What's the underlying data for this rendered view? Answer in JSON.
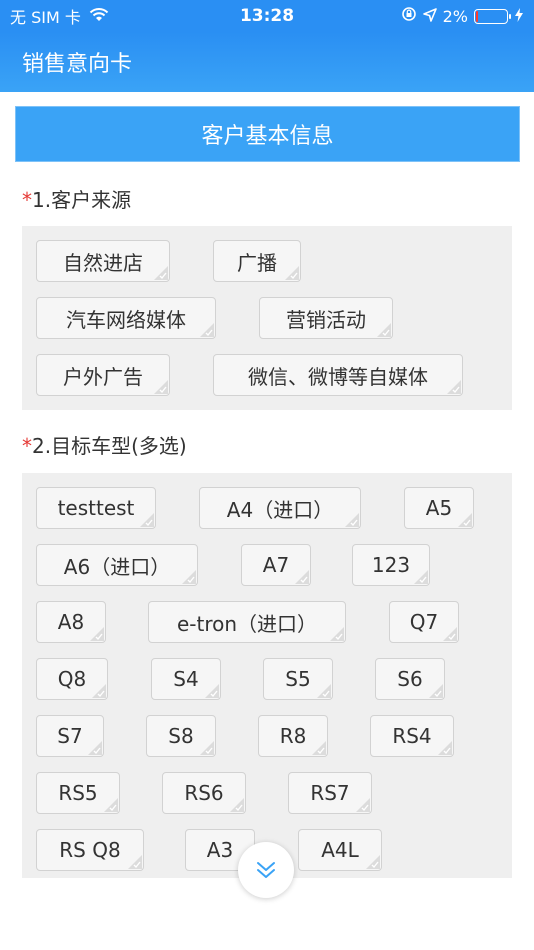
{
  "status": {
    "carrier": "无 SIM 卡",
    "time": "13:28",
    "battery": "2%",
    "battery_level": 0.02,
    "battery_color": "#ff3b30"
  },
  "nav": {
    "title": "销售意向卡"
  },
  "section": {
    "title": "客户基本信息"
  },
  "q1": {
    "required_mark": "*",
    "label": "1.客户来源",
    "options": [
      "自然进店",
      "广播",
      "汽车网络媒体",
      "营销活动",
      "户外广告",
      "微信、微博等自媒体"
    ]
  },
  "q2": {
    "required_mark": "*",
    "label": "2.目标车型(多选)",
    "options": [
      "testtest",
      "A4（进口）",
      "A5",
      "A6（进口）",
      "A7",
      "123",
      "A8",
      "e-tron（进口）",
      "Q7",
      "Q8",
      "S4",
      "S5",
      "S6",
      "S7",
      "S8",
      "R8",
      "RS4",
      "RS5",
      "RS6",
      "RS7",
      "RS Q8",
      "A3",
      "A4L"
    ]
  },
  "colors": {
    "primary": "#2a8ff3",
    "header": "#3aa3f6",
    "required": "#e53935",
    "panel": "#efefef"
  }
}
